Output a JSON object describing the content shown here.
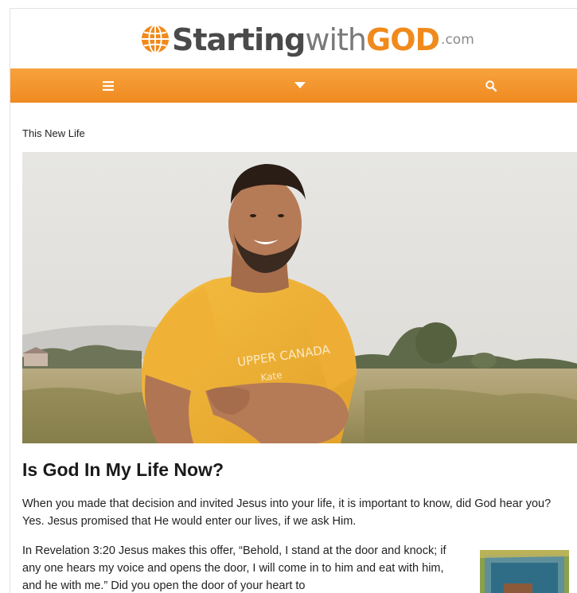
{
  "brand": {
    "starting": "Starting",
    "with": "with",
    "god": "GOD",
    "com": ".com",
    "accent_color": "#f08a1c",
    "globe_icon": "globe-icon"
  },
  "navbar": {
    "background": "#ef8a1f",
    "menu_icon": "hamburger-menu-icon",
    "dropdown_icon": "caret-down-icon",
    "search_icon": "search-icon"
  },
  "breadcrumb": {
    "current": "This New Life"
  },
  "hero": {
    "shirt_text": "UPPER CANADA",
    "shirt_subtext": "Kate"
  },
  "article": {
    "title": "Is God In My Life Now?",
    "paragraph_1": "When you made that decision and invited Jesus into your life, it is important to know, did God hear you? Yes. Jesus promised that He would enter our lives, if we ask Him.",
    "paragraph_2": "In Revelation 3:20 Jesus makes this offer, “Behold, I stand at the door and knock; if any one hears my voice and opens the door, I will come in to him and eat with him, and he with me.” Did you open the door of your heart to"
  }
}
